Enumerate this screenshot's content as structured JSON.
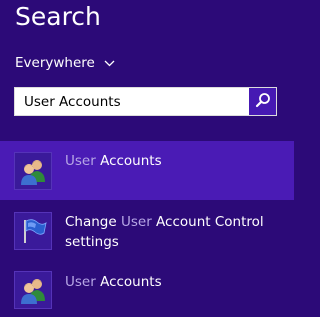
{
  "pane": {
    "title": "Search",
    "scope_label": "Everywhere"
  },
  "search": {
    "value": "User Accounts",
    "button_icon": "magnifier-icon"
  },
  "colors": {
    "background": "#2c0a78",
    "selected_row": "#4a1bb5",
    "search_button": "#4619b3",
    "match_highlight": "#b7a7e6"
  },
  "results": [
    {
      "icon": "user-accounts-icon",
      "match": "User",
      "rest_line1": " Accounts",
      "line2": ""
    },
    {
      "icon": "uac-flag-icon",
      "prefix": "Change ",
      "match": "User",
      "rest_line1": " Account Control",
      "line2": "settings"
    },
    {
      "icon": "user-accounts-icon",
      "match": "User",
      "rest_line1": " Accounts",
      "line2": ""
    }
  ]
}
